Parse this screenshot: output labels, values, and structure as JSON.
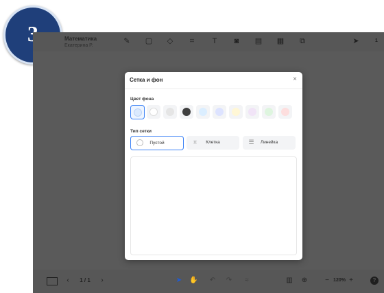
{
  "step_badge": "3",
  "header": {
    "title": "Математика",
    "subtitle": "Екатерина Р.",
    "right_count": "1"
  },
  "modal": {
    "title": "Сетка и фон",
    "close": "×",
    "bg_label": "Цвет фона",
    "colors": [
      "#dbeafe",
      "#ffffff",
      "#e5e5e5",
      "#3f3f3f",
      "#dbeeff",
      "#dde3ff",
      "#fff7d6",
      "#f1e4f7",
      "#def5df",
      "#fddede"
    ],
    "grid_label": "Тип сетки",
    "grid_options": [
      {
        "label": "Пустой",
        "icon": "circle-icon",
        "selected": true
      },
      {
        "label": "Клетка",
        "icon": "grid-icon",
        "selected": false
      },
      {
        "label": "Линейка",
        "icon": "lines-icon",
        "selected": false
      }
    ]
  },
  "bottom": {
    "pages": "1 / 1",
    "zoom": "120%",
    "help": "?"
  },
  "colors": {
    "accent": "#3b82f6",
    "badge": "#1f3f7a"
  }
}
